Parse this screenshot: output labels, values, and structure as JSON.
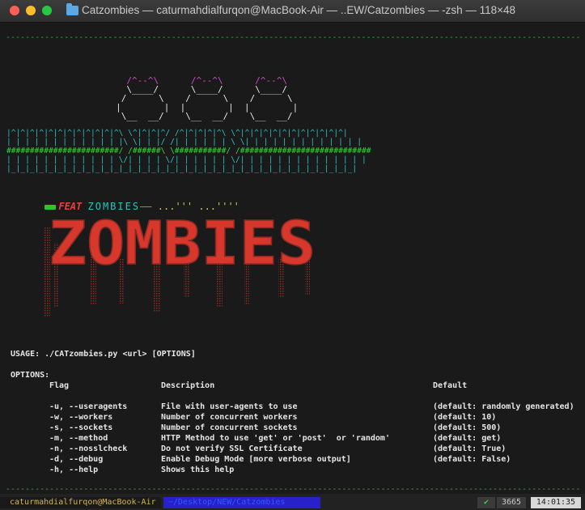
{
  "window": {
    "title": "Catzombies — caturmahdialfurqon@MacBook-Air — ..EW/Catzombies — -zsh — 118×48"
  },
  "banner": {
    "dashes": "----------------------------------------------------------------------------------------------------------------------",
    "cat_ears": "       /^--^\\      /^--^\\      /^--^\\",
    "cat_line2": "       \\____/      \\____/      \\____/",
    "cat_line3": "      /      \\    /      \\    /      \\",
    "cat_line4": "     |        |  |        |  |        |",
    "cat_line5": "      \\__  __/    \\__  __/    \\__  __/",
    "fence1": "|^|^|^|^|^|^|^|^|^|^|^|^\\ \\^|^|^|^/ /^|^|^|^|^\\ \\^|^|^|^|^|^|^|^|^|^|^|^|",
    "fence2": "| | | | | | | | | | | | |\\ \\| | |/ /| | | | | | \\ \\| | | | | | | | | | | | |",
    "fence3": "########################/ /######\\ \\###########/ /############################",
    "fence4": "| | | | | | | | | | | | \\/| | | | \\/| | | | | | \\/| | | | | | | | | | | | | |",
    "fence5": "|_|_|_|_|_|_|_|_|_|_|_|_|_|_|_|_|_|_|_|_|_|_|_|_|_|_|_|_|_|_|_|_|_|_|_|_|_|"
  },
  "subtitle": {
    "feat": "FEAT",
    "zombies": "ZOMBIES",
    "dashes": "——",
    "dots": "...''' ...''''"
  },
  "logo_text": "ZOMBIES",
  "usage": "USAGE: ./CATzombies.py <url> [OPTIONS]",
  "options_header": "OPTIONS:",
  "columns": {
    "flag": "Flag",
    "description": "Description",
    "default": "Default"
  },
  "options": [
    {
      "flag": "-u, --useragents",
      "description": "File with user-agents to use",
      "default": "(default: randomly generated)"
    },
    {
      "flag": "-w, --workers",
      "description": "Number of concurrent workers",
      "default": "(default: 10)"
    },
    {
      "flag": "-s, --sockets",
      "description": "Number of concurrent sockets",
      "default": "(default: 500)"
    },
    {
      "flag": "-m, --method",
      "description": "HTTP Method to use 'get' or 'post'  or 'random'",
      "default": "(default: get)"
    },
    {
      "flag": "-n, --nosslcheck",
      "description": "Do not verify SSL Certificate",
      "default": "(default: True)"
    },
    {
      "flag": "-d, --debug",
      "description": "Enable Debug Mode [more verbose output]",
      "default": "(default: False)"
    },
    {
      "flag": "-h, --help",
      "description": "Shows this help",
      "default": ""
    }
  ],
  "prompt": {
    "user": "caturmahdialfurqon@MacBook-Air",
    "path": "~/Desktop/NEW/Catzombies",
    "status": "✔",
    "count": "3665",
    "time": "14:01:35"
  },
  "colors": {
    "dash_green": "#2fb52f",
    "cat_magenta": "#d046d0",
    "fence_cyan": "#2ac3c3",
    "logo_red": "#d8372c",
    "prompt_blue": "#2820c8"
  }
}
